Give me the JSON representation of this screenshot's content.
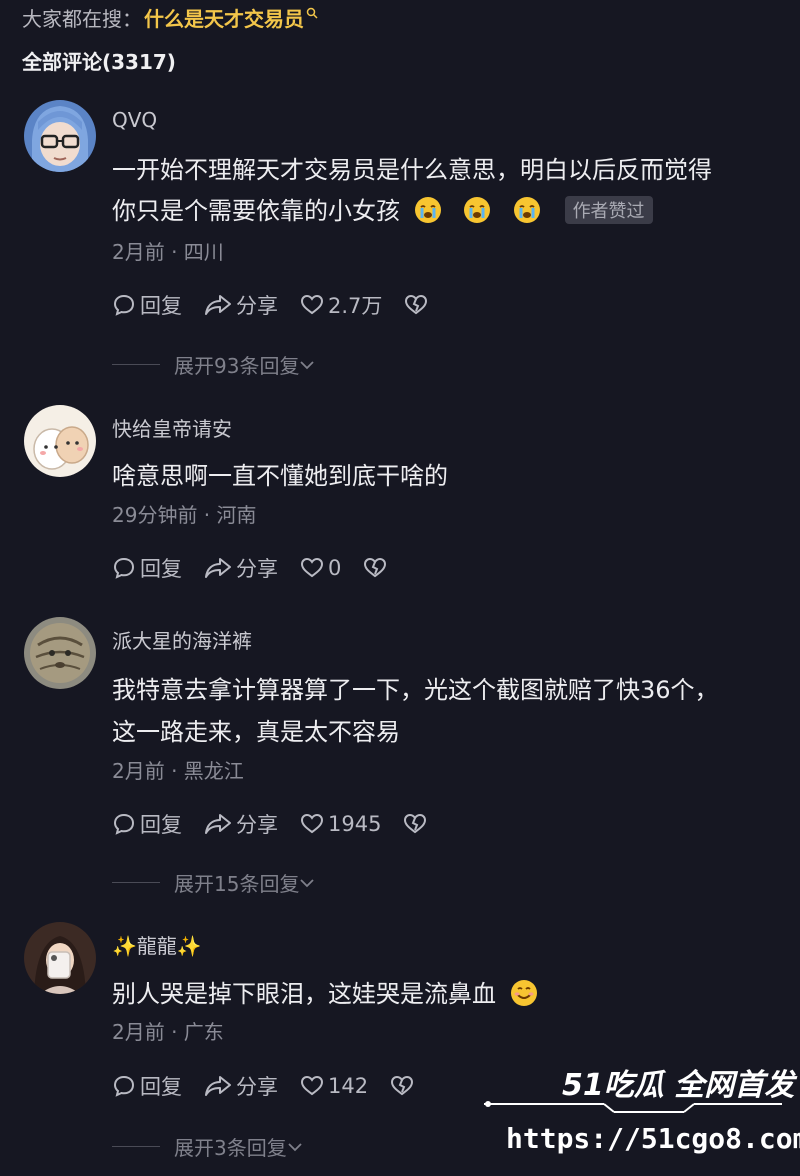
{
  "search": {
    "prefix": "大家都在搜：",
    "term": "什么是天才交易员"
  },
  "header": {
    "title": "全部评论(3317)"
  },
  "actions_labels": {
    "reply": "回复",
    "share": "分享"
  },
  "comments": [
    {
      "username": "QVQ",
      "lines": [
        "一开始不理解天才交易员是什么意思，明白以后反而觉得",
        "你只是个需要依靠的小女孩"
      ],
      "emoji": "crying-face",
      "badge": "作者赞过",
      "meta": "2月前 · 四川",
      "likes": "2.7万",
      "expand": "展开93条回复"
    },
    {
      "username": "快给皇帝请安",
      "lines": [
        "啥意思啊一直不懂她到底干啥的"
      ],
      "meta": "29分钟前 · 河南",
      "likes": "0"
    },
    {
      "username": "派大星的海洋裤",
      "lines": [
        "我特意去拿计算器算了一下，光这个截图就赔了快36个，",
        "这一路走来，真是太不容易"
      ],
      "meta": "2月前 · 黑龙江",
      "likes": "1945",
      "expand": "展开15条回复"
    },
    {
      "username": "✨龍龍✨",
      "lines": [
        "别人哭是掉下眼泪，这娃哭是流鼻血"
      ],
      "emoji": "smiling-face",
      "meta": "2月前 · 广东",
      "likes": "142",
      "expand": "展开3条回复"
    }
  ],
  "watermark": {
    "brand": "51吃瓜 全网首发",
    "url": "https://51cgo8.com"
  }
}
